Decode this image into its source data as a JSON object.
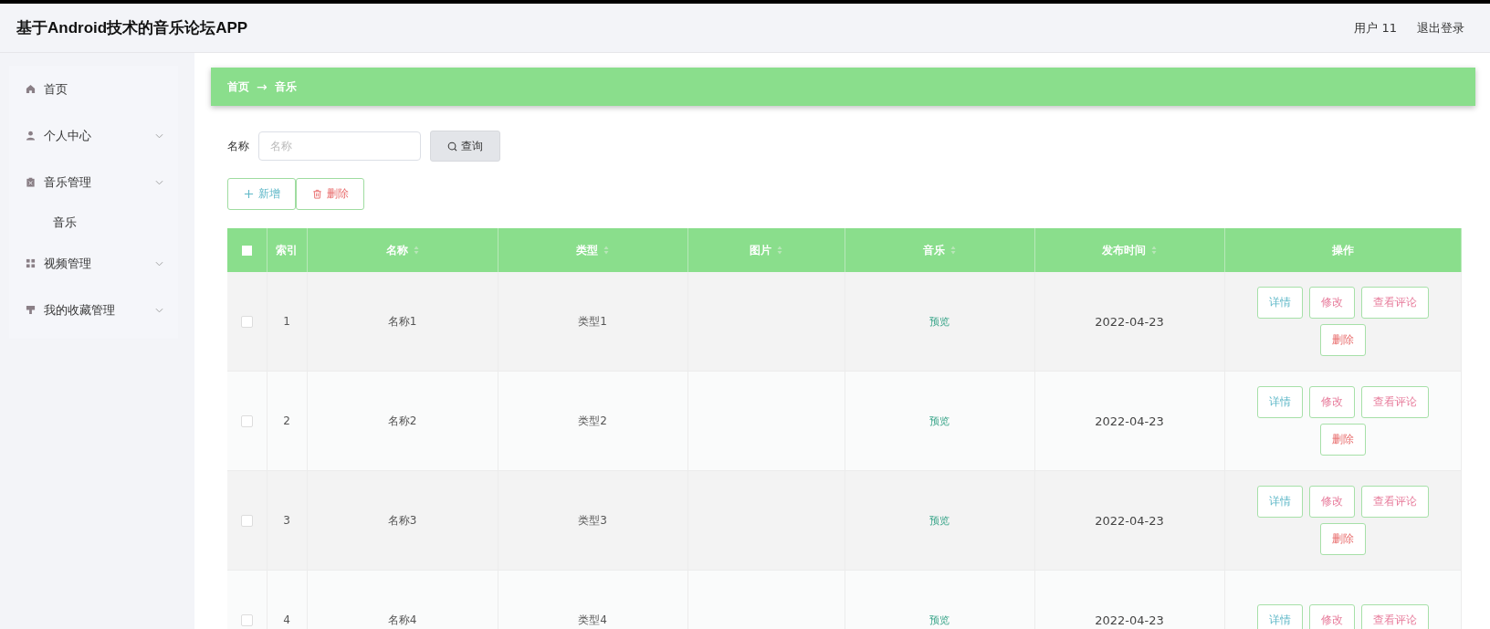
{
  "header": {
    "title": "基于Android技术的音乐论坛APP",
    "user": "用户 11",
    "logout": "退出登录"
  },
  "sidebar": {
    "items": [
      {
        "label": "首页",
        "kind": "link"
      },
      {
        "label": "个人中心",
        "kind": "submenu"
      },
      {
        "label": "音乐管理",
        "kind": "submenu",
        "children": [
          {
            "label": "音乐"
          }
        ]
      },
      {
        "label": "视频管理",
        "kind": "submenu"
      },
      {
        "label": "我的收藏管理",
        "kind": "submenu"
      }
    ]
  },
  "breadcrumb": {
    "items": [
      "首页",
      "音乐"
    ],
    "separator": "→"
  },
  "search": {
    "label": "名称",
    "placeholder": "名称",
    "button": "查询"
  },
  "toolbar": [
    {
      "kind": "add",
      "label": "新增"
    },
    {
      "kind": "delete",
      "label": "删除"
    }
  ],
  "table": {
    "select_all_checked": false,
    "columns": [
      {
        "label": "索引",
        "sortable": false
      },
      {
        "label": "名称",
        "sortable": true
      },
      {
        "label": "类型",
        "sortable": true
      },
      {
        "label": "图片",
        "sortable": true
      },
      {
        "label": "音乐",
        "sortable": true
      },
      {
        "label": "发布时间",
        "sortable": true
      },
      {
        "label": "操作",
        "sortable": false
      }
    ],
    "rows": [
      {
        "checked": false,
        "index": "1",
        "name": "名称1",
        "type": "类型1",
        "music": "预览",
        "date": "2022-04-23",
        "actions": [
          {
            "kind": "detail",
            "label": "详情"
          },
          {
            "kind": "edit",
            "label": "修改"
          },
          {
            "kind": "comments",
            "label": "查看评论"
          },
          {
            "kind": "delete",
            "label": "删除"
          }
        ]
      },
      {
        "checked": false,
        "index": "2",
        "name": "名称2",
        "type": "类型2",
        "music": "预览",
        "date": "2022-04-23",
        "actions": [
          {
            "kind": "detail",
            "label": "详情"
          },
          {
            "kind": "edit",
            "label": "修改"
          },
          {
            "kind": "comments",
            "label": "查看评论"
          },
          {
            "kind": "delete",
            "label": "删除"
          }
        ]
      },
      {
        "checked": false,
        "index": "3",
        "name": "名称3",
        "type": "类型3",
        "music": "预览",
        "date": "2022-04-23",
        "actions": [
          {
            "kind": "detail",
            "label": "详情"
          },
          {
            "kind": "edit",
            "label": "修改"
          },
          {
            "kind": "comments",
            "label": "查看评论"
          },
          {
            "kind": "delete",
            "label": "删除"
          }
        ]
      },
      {
        "checked": false,
        "index": "4",
        "name": "名称4",
        "type": "类型4",
        "music": "预览",
        "date": "2022-04-23",
        "actions": [
          {
            "kind": "detail",
            "label": "详情"
          },
          {
            "kind": "edit",
            "label": "修改"
          },
          {
            "kind": "comments",
            "label": "查看评论"
          }
        ]
      }
    ]
  }
}
